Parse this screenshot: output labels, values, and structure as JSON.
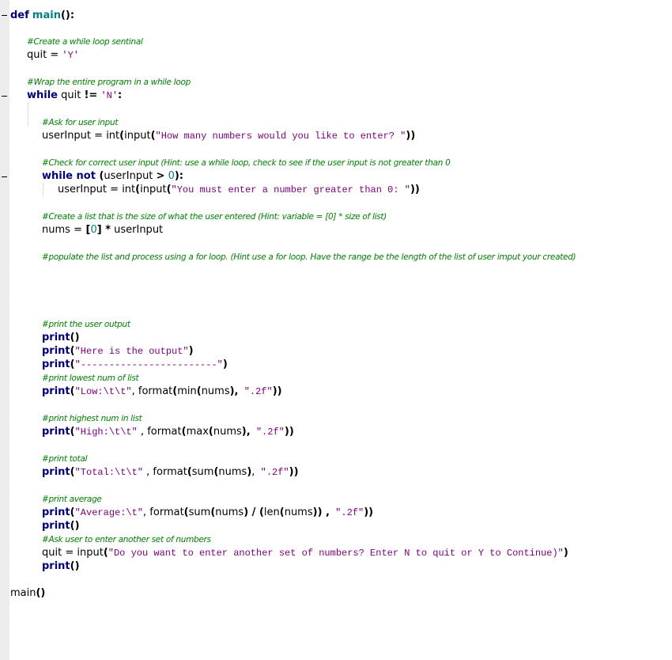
{
  "editor": {
    "language": "python",
    "colors": {
      "keyword": "#000080",
      "function_name": "#008080",
      "number": "#008080",
      "string": "#800080",
      "comment": "#008000",
      "default": "#000000"
    },
    "lines": {
      "l0": {
        "kw": "def",
        "fn": "main",
        "op": "():"
      },
      "l2": {
        "comment": "#Create a while loop sentinal"
      },
      "l3": {
        "a": "quit ",
        "op": "=",
        "s": "'Y'"
      },
      "l5": {
        "comment": "#Wrap the entire program in a while loop"
      },
      "l6": {
        "kw": "while",
        "a": " quit ",
        "op": "!=",
        "s": "'N'",
        "op2": ":"
      },
      "l8": {
        "comment": "#Ask for user input"
      },
      "l9": {
        "a": "userInput ",
        "op": "=",
        "b": " int",
        "op2": "(",
        "c": "input",
        "op3": "(",
        "s": "\"How many numbers would you like to enter? \"",
        "op4": "))"
      },
      "l11": {
        "comment": "#Check for correct user input (Hint: use a while loop, check to see if the user input is not greater than 0"
      },
      "l12": {
        "kw": "while not",
        "op": " (",
        "a": "userInput ",
        "op2": ">",
        "n": " 0",
        "op3": "):"
      },
      "l13": {
        "a": "userInput ",
        "op": "=",
        "b": " int",
        "op2": "(",
        "c": "input",
        "op3": "(",
        "s": "\"You must enter a number greater than 0: \"",
        "op4": "))"
      },
      "l15": {
        "comment": "#Create a list that is the size of what the user entered (Hint: variable = [0] * size of list)"
      },
      "l16": {
        "a": "nums ",
        "op": "=",
        "op2": " [",
        "n": "0",
        "op3": "]",
        "op4": " *",
        "b": " userInput"
      },
      "l18": {
        "comment": "#populate the list and process using a for loop. (Hint use a for loop. Have the range be the length of the list of user imput your created)"
      },
      "l23": {
        "comment": "#print the user output"
      },
      "l24": {
        "kw": "print",
        "op": "()"
      },
      "l25": {
        "kw": "print",
        "op": "(",
        "s": "\"Here is the output\"",
        "op2": ")"
      },
      "l26": {
        "kw": "print",
        "op": "(",
        "s": "\"------------------------\"",
        "op2": ")"
      },
      "l27": {
        "comment": "#print lowest num of list"
      },
      "l28": {
        "kw": "print",
        "op": "(",
        "s": "\"Low:\\t\\t\"",
        "a": ", format",
        "op2": "(",
        "b": "min",
        "op3": "(",
        "c": "nums",
        "op4": "),",
        "s2": " \".2f\"",
        "op5": "))"
      },
      "l30": {
        "comment": "#print highest num in list"
      },
      "l31": {
        "kw": "print",
        "op": "(",
        "s": "\"High:\\t\\t\"",
        "a": " , format",
        "op2": "(",
        "b": "max",
        "op3": "(",
        "c": "nums",
        "op4": "),",
        "s2": " \".2f\"",
        "op5": "))"
      },
      "l33": {
        "comment": "#print total"
      },
      "l34": {
        "kw": "print",
        "op": "(",
        "s": "\"Total:\\t\\t\"",
        "a": " , format",
        "op2": "(",
        "b": "sum",
        "op3": "(",
        "c": "nums",
        "op4": ")",
        "op5": ",",
        "s2": " \".2f\"",
        "op6": "))"
      },
      "l36": {
        "comment": "#print average"
      },
      "l37": {
        "kw": "print",
        "op": "(",
        "s": "\"Average:\\t\"",
        "a": ", format",
        "op2": "(",
        "b": "sum",
        "op3": "(",
        "c": "nums",
        "op4": ")",
        "op5": " / (",
        "d": "len",
        "op6": "(",
        "e": "nums",
        "op7": ")) ,",
        "s2": " \".2f\"",
        "op8": "))"
      },
      "l38": {
        "kw": "print",
        "op": "()"
      },
      "l39": {
        "comment": "#Ask user to enter another set of numbers"
      },
      "l40": {
        "a": "quit ",
        "op": "=",
        "b": " input",
        "op2": "(",
        "s": "\"Do you want to enter another set of numbers? Enter N to quit or Y to Continue)\"",
        "op3": ")"
      },
      "l41": {
        "kw": "print",
        "op": "()"
      },
      "l43": {
        "a": "main",
        "op": "()"
      }
    }
  }
}
